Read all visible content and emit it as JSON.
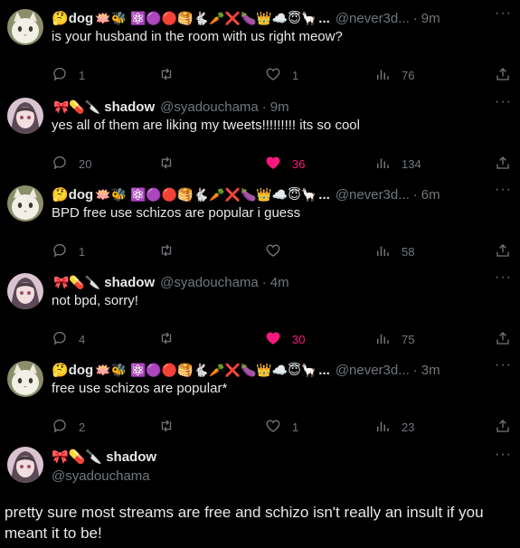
{
  "tweets": [
    {
      "name": "dog",
      "emojis": "🪷🐝 ⚛️🟣🔴🥞🐇🥕❌🍆👑☁️😇🦙",
      "ellipsis": "...",
      "handle": "@never3d...",
      "time": "9m",
      "text": "is your husband in the room with us right meow?",
      "reply_count": "1",
      "retweet_count": "",
      "like_count": "1",
      "view_count": "76",
      "liked": false,
      "avatar": "cat"
    },
    {
      "name": "shadow",
      "emojis": "🎀💊🔪",
      "ellipsis": "",
      "handle": "@syadouchama",
      "time": "9m",
      "text": "yes all of them are liking my tweets!!!!!!!!! its so cool",
      "reply_count": "20",
      "retweet_count": "",
      "like_count": "36",
      "view_count": "134",
      "liked": true,
      "avatar": "anime"
    },
    {
      "name": "dog",
      "emojis": "🪷🐝 ⚛️🟣🔴🥞🐇🥕❌🍆👑☁️😇🦙",
      "ellipsis": "...",
      "handle": "@never3d...",
      "time": "6m",
      "text": "BPD free use schizos are popular i guess",
      "reply_count": "1",
      "retweet_count": "",
      "like_count": "",
      "view_count": "58",
      "liked": false,
      "avatar": "cat"
    },
    {
      "name": "shadow",
      "emojis": "🎀💊🔪",
      "ellipsis": "",
      "handle": "@syadouchama",
      "time": "4m",
      "text": "not bpd, sorry!",
      "reply_count": "4",
      "retweet_count": "",
      "like_count": "30",
      "view_count": "75",
      "liked": true,
      "avatar": "anime"
    },
    {
      "name": "dog",
      "emojis": "🪷🐝 ⚛️🟣🔴🥞🐇🥕❌🍆👑☁️😇🦙",
      "ellipsis": "...",
      "handle": "@never3d...",
      "time": "3m",
      "text": "free use schizos are popular*",
      "reply_count": "2",
      "retweet_count": "",
      "like_count": "1",
      "view_count": "23",
      "liked": false,
      "avatar": "cat"
    }
  ],
  "final": {
    "emojis": "🎀💊🔪",
    "name": "shadow",
    "handle": "@syadouchama",
    "text": "pretty sure most streams are free and schizo isn't really an insult if you meant it to be!"
  },
  "more_label": "···",
  "dot": "·",
  "colors": {
    "like": "#f91880",
    "muted": "#71767b",
    "text": "#e7e9ea"
  },
  "icons": [
    "reply-icon",
    "retweet-icon",
    "heart-icon",
    "views-icon",
    "share-icon",
    "more-icon"
  ]
}
